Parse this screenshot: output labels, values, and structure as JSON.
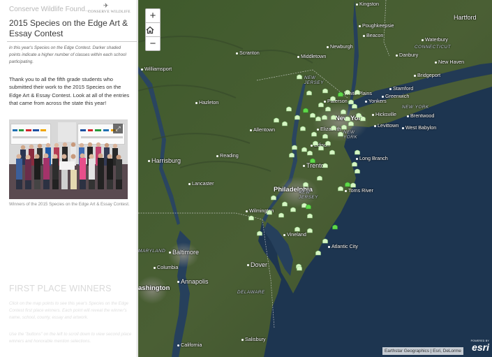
{
  "sidebar": {
    "org_name": "Conserve Wildlife Found...",
    "logo_text": "CONSERVE WILDLIFE",
    "title": "2015 Species on the Edge Art & Essay Contest",
    "intro": "in this year's Species on the Edge Contest. Darker shaded points indicate a higher number of classes within each school participating.",
    "thanks": "Thank you to all the fifth grade students who submitted their work to the 2015 Species on the Edge Art & Essay Contest. Look at all of the entries that came from across the state this year!",
    "photo_caption": "Winners of the 2015 Species on the Edge Art & Essay Contest.",
    "section_heading": "FIRST PLACE WINNERS",
    "section_p1": "Click on the map points to see this year's Species on the Edge Contest first place winners. Each point will reveal the winner's name, school, county, essay and artwork.",
    "section_p2": "Use the \"buttons\" on the left to scroll down to view second place winners and honorable mention selections."
  },
  "map": {
    "zoom_in": "+",
    "zoom_out": "−",
    "home_icon": "home-icon",
    "attribution": "Earthstar Geographics | Esri, DeLorme",
    "powered_by": "POWERED BY",
    "esri": "esri",
    "colors": {
      "marker_light": "#d6f5c4",
      "marker_dark": "#5fd94a",
      "water": "#1d3550"
    },
    "places": [
      {
        "id": "kingston",
        "name": "Kingston"
      },
      {
        "id": "hartford",
        "name": "Hartford"
      },
      {
        "id": "poughkeepsie",
        "name": "Poughkeepsie"
      },
      {
        "id": "beacon",
        "name": "Beacon"
      },
      {
        "id": "waterbury",
        "name": "Waterbury"
      },
      {
        "id": "newburgh",
        "name": "Newburgh"
      },
      {
        "id": "connecticut",
        "name": "CONNECTICUT"
      },
      {
        "id": "danbury",
        "name": "Danbury"
      },
      {
        "id": "scranton",
        "name": "Scranton"
      },
      {
        "id": "middletown",
        "name": "Middletown"
      },
      {
        "id": "new-haven",
        "name": "New Haven"
      },
      {
        "id": "williamsport",
        "name": "Williamsport"
      },
      {
        "id": "bridgeport",
        "name": "Bridgeport"
      },
      {
        "id": "new-jersey-n",
        "name": "NEW JERSEY"
      },
      {
        "id": "stamford",
        "name": "Stamford"
      },
      {
        "id": "hazleton",
        "name": "Hazleton"
      },
      {
        "id": "paterson",
        "name": "Paterson"
      },
      {
        "id": "white-plains",
        "name": "White Plains"
      },
      {
        "id": "greenwich",
        "name": "Greenwich"
      },
      {
        "id": "yonkers",
        "name": "Yonkers"
      },
      {
        "id": "new-york-state",
        "name": "NEW YORK"
      },
      {
        "id": "hicksville",
        "name": "Hicksville"
      },
      {
        "id": "brentwood",
        "name": "Brentwood"
      },
      {
        "id": "new-york",
        "name": "New York"
      },
      {
        "id": "levittown",
        "name": "Levittown"
      },
      {
        "id": "west-babylon",
        "name": "West Babylon"
      },
      {
        "id": "allentown",
        "name": "Allentown"
      },
      {
        "id": "elizabeth",
        "name": "Elizabeth"
      },
      {
        "id": "new-york-label",
        "name": "NEW YORK"
      },
      {
        "id": "harrisburg",
        "name": "Harrisburg"
      },
      {
        "id": "reading",
        "name": "Reading"
      },
      {
        "id": "edison",
        "name": "Edison"
      },
      {
        "id": "trenton",
        "name": "Trenton"
      },
      {
        "id": "long-branch",
        "name": "Long Branch"
      },
      {
        "id": "lancaster",
        "name": "Lancaster"
      },
      {
        "id": "philadelphia",
        "name": "Philadelphia"
      },
      {
        "id": "toms-river",
        "name": "Toms River"
      },
      {
        "id": "new-jersey-s",
        "name": "NEW JERSEY"
      },
      {
        "id": "wilmington",
        "name": "Wilmington"
      },
      {
        "id": "maryland",
        "name": "MARYLAND"
      },
      {
        "id": "baltimore",
        "name": "Baltimore"
      },
      {
        "id": "vineland",
        "name": "Vineland"
      },
      {
        "id": "atlantic-city",
        "name": "Atlantic City"
      },
      {
        "id": "columbia",
        "name": "Columbia"
      },
      {
        "id": "dover",
        "name": "Dover"
      },
      {
        "id": "annapolis",
        "name": "Annapolis"
      },
      {
        "id": "washington",
        "name": "ashington"
      },
      {
        "id": "delaware",
        "name": "DELAWARE"
      },
      {
        "id": "california",
        "name": "California"
      },
      {
        "id": "salisbury",
        "name": "Salisbury"
      }
    ]
  }
}
